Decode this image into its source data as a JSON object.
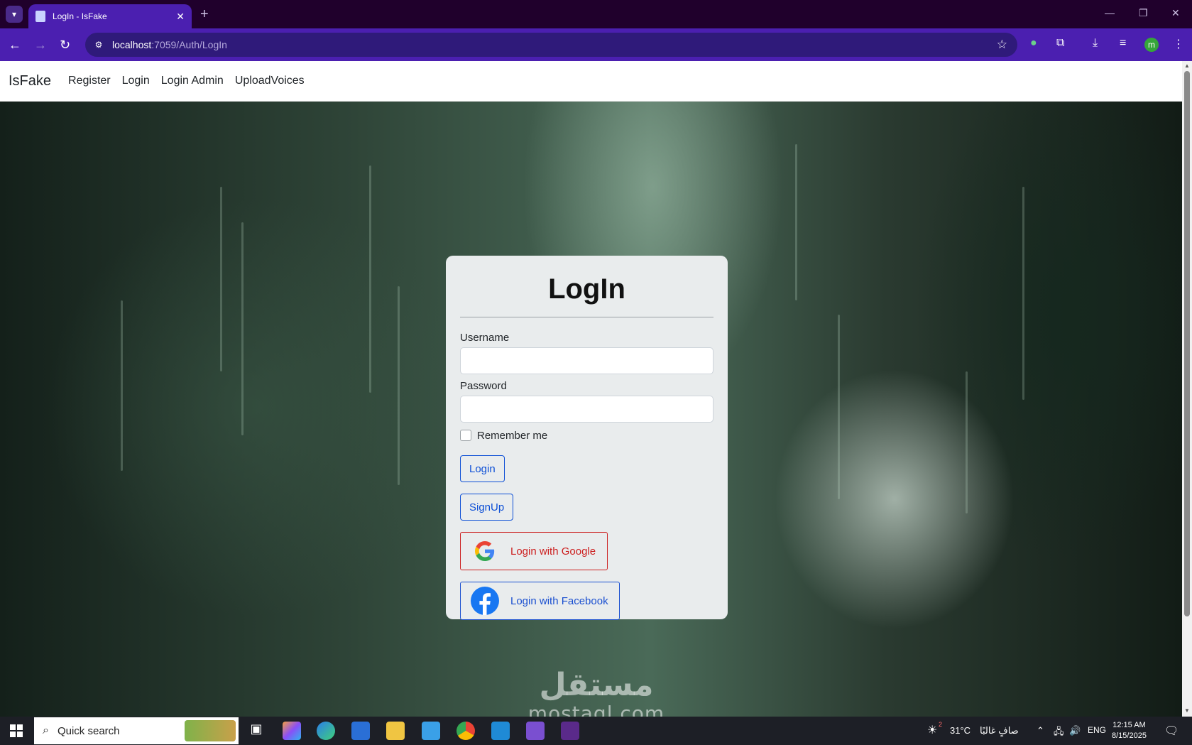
{
  "browser": {
    "tab_title": "LogIn - IsFake",
    "url_host": "localhost",
    "url_path": ":7059/Auth/LogIn"
  },
  "navbar": {
    "brand": "IsFake",
    "links": [
      "Register",
      "Login",
      "Login Admin",
      "UploadVoices"
    ]
  },
  "login_card": {
    "title": "LogIn",
    "username_label": "Username",
    "password_label": "Password",
    "remember_label": "Remember me",
    "login_button": "Login",
    "signup_button": "SignUp",
    "google_button": "Login with Google",
    "facebook_button": "Login with Facebook"
  },
  "watermark": {
    "arabic": "مستقل",
    "latin": "mostaql.com"
  },
  "taskbar": {
    "search_placeholder": "Quick search",
    "weather": "31°C",
    "weather_desc": "صافٍ غالبًا",
    "weather_badge": "2",
    "language": "ENG",
    "time": "12:15 AM",
    "date": "8/15/2025"
  },
  "colors": {
    "chrome_purple": "#4b1fb0",
    "tabstrip": "#20002c",
    "card_bg": "#e9eced",
    "primary_blue": "#0d4fd6",
    "google_red": "#cc1f1f"
  }
}
